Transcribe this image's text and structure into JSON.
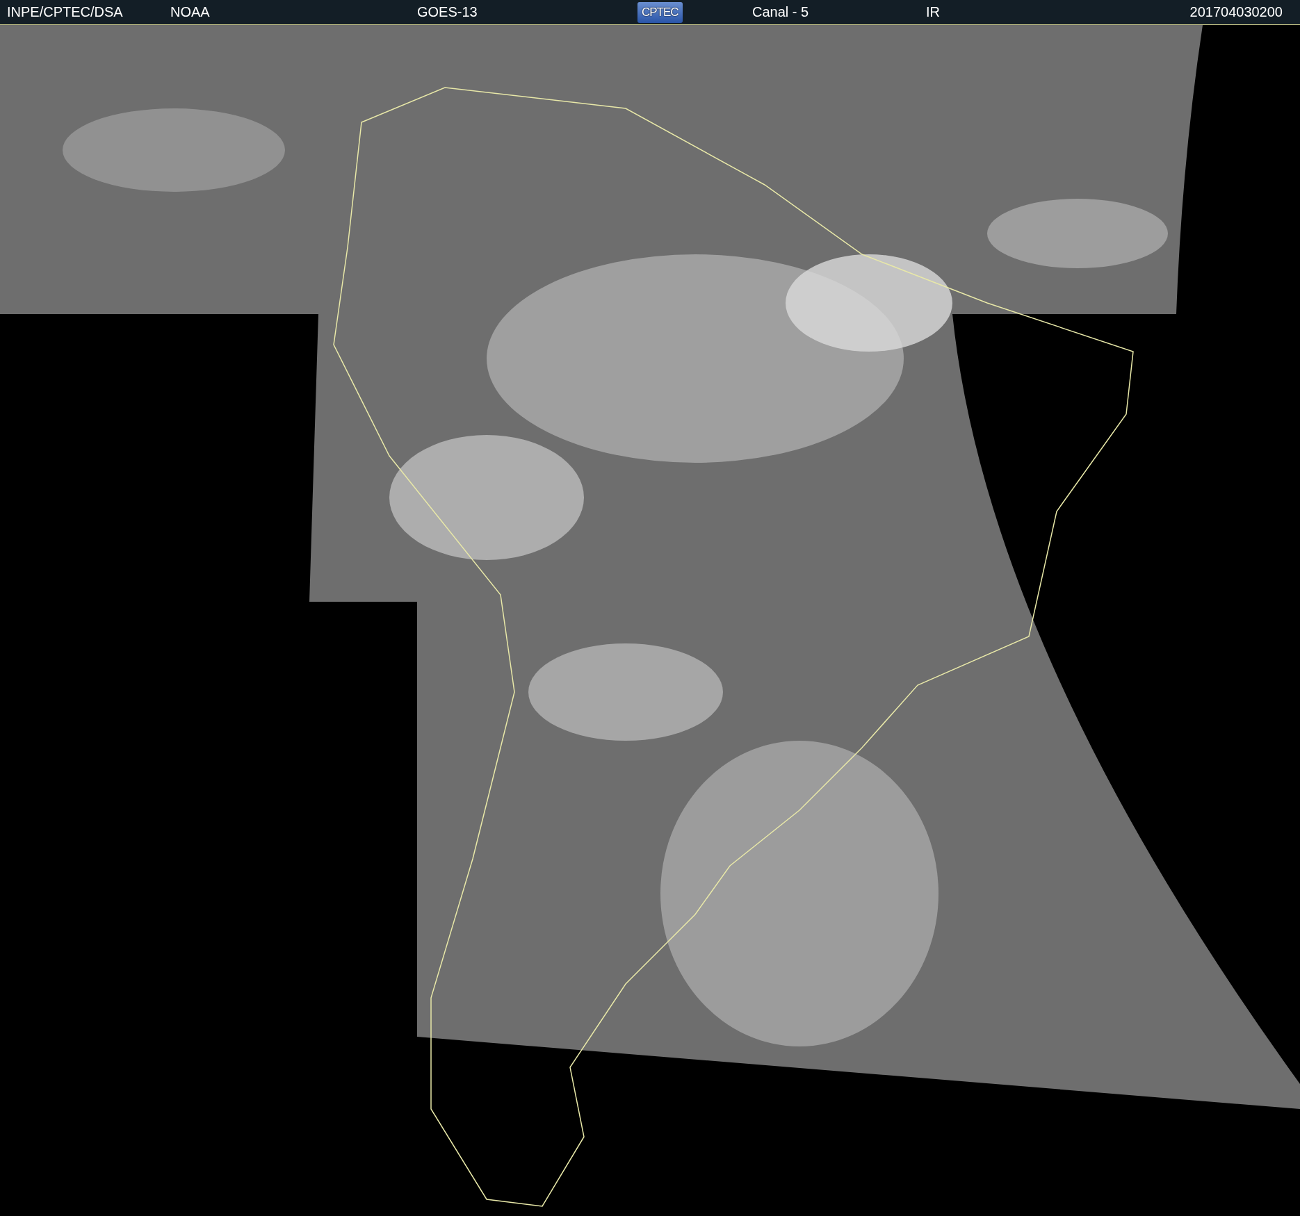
{
  "header": {
    "source": "INPE/CPTEC/DSA",
    "agency": "NOAA",
    "satellite": "GOES-13",
    "logo": "CPTEC",
    "channel": "Canal - 5",
    "band": "IR",
    "timestamp": "201704030200"
  }
}
